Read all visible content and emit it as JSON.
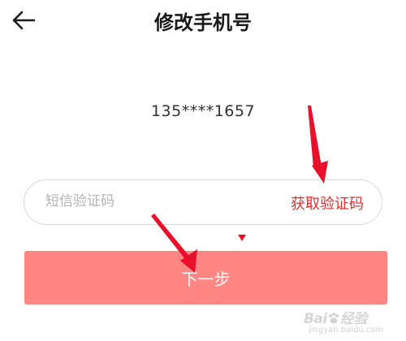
{
  "header": {
    "title": "修改手机号"
  },
  "phone": {
    "masked_number": "135****1657"
  },
  "code_field": {
    "placeholder": "短信验证码",
    "value": ""
  },
  "get_code_button": {
    "label": "获取验证码"
  },
  "next_button": {
    "label": "下一步"
  },
  "watermark": {
    "brand_left": "Bai",
    "brand_right": "经验",
    "url": "jingyan.baidu.com"
  },
  "colors": {
    "accent_red": "#e03030",
    "button_bg": "#ff8683",
    "annotation_red": "#e8102a"
  },
  "icons": {
    "back": "arrow-left-icon"
  }
}
